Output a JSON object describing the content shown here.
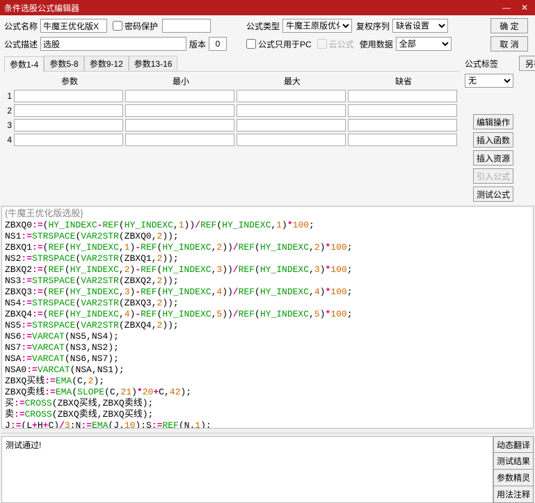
{
  "title": "条件选股公式编辑器",
  "win": {
    "min": "—",
    "close": "✕"
  },
  "labels": {
    "name": "公式名称",
    "pwd": "密码保护",
    "desc": "公式描述",
    "ver": "版本",
    "type": "公式类型",
    "seq": "复权序列",
    "pconly": "公式只用于PC",
    "cloud": "云公式",
    "usedata": "使用数据",
    "tag": "公式标签"
  },
  "vals": {
    "name": "牛魔王优化版X",
    "desc": "选股",
    "ver": "0",
    "type": "牛魔王原版优化",
    "seq": "缺省设置",
    "usedata": "全部",
    "tag": "无"
  },
  "buttons": {
    "ok": "确 定",
    "cancel": "取 消",
    "saveas": "另存为",
    "editop": "编辑操作",
    "insfunc": "插入函数",
    "insres": "插入资源",
    "import": "引入公式",
    "test": "测试公式",
    "dyn": "动态翻译",
    "result": "测试结果",
    "paramwiz": "参数精灵",
    "usage": "用法注释"
  },
  "tabs": [
    "参数1-4",
    "参数5-8",
    "参数9-12",
    "参数13-16"
  ],
  "paramHeaders": [
    "参数",
    "最小",
    "最大",
    "缺省"
  ],
  "paramRows": [
    "1",
    "2",
    "3",
    "4"
  ],
  "codeTitle": "{牛魔王优化版选股}",
  "code": [
    {
      "segs": [
        [
          "k",
          "ZBXQ0"
        ],
        [
          "o",
          ":="
        ],
        [
          "p",
          "("
        ],
        [
          "f",
          "HY_INDEXC"
        ],
        [
          "o",
          "-"
        ],
        [
          "f",
          "REF"
        ],
        [
          "p",
          "("
        ],
        [
          "f",
          "HY_INDEXC"
        ],
        [
          "p",
          ","
        ],
        [
          "n",
          "1"
        ],
        [
          "p",
          "))"
        ],
        [
          "o",
          "/"
        ],
        [
          "f",
          "REF"
        ],
        [
          "p",
          "("
        ],
        [
          "f",
          "HY_INDEXC"
        ],
        [
          "p",
          ","
        ],
        [
          "n",
          "1"
        ],
        [
          "p",
          ")"
        ],
        [
          "o",
          "*"
        ],
        [
          "n",
          "100"
        ],
        [
          "p",
          ";"
        ]
      ]
    },
    {
      "segs": [
        [
          "k",
          "NS1"
        ],
        [
          "o",
          ":="
        ],
        [
          "f",
          "STRSPACE"
        ],
        [
          "p",
          "("
        ],
        [
          "f",
          "VAR2STR"
        ],
        [
          "p",
          "("
        ],
        [
          "k",
          "ZBXQ0"
        ],
        [
          "p",
          ","
        ],
        [
          "n",
          "2"
        ],
        [
          "p",
          "));"
        ]
      ]
    },
    {
      "segs": [
        [
          "k",
          "ZBXQ1"
        ],
        [
          "o",
          ":="
        ],
        [
          "p",
          "("
        ],
        [
          "f",
          "REF"
        ],
        [
          "p",
          "("
        ],
        [
          "f",
          "HY_INDEXC"
        ],
        [
          "p",
          ","
        ],
        [
          "n",
          "1"
        ],
        [
          "p",
          ")"
        ],
        [
          "o",
          "-"
        ],
        [
          "f",
          "REF"
        ],
        [
          "p",
          "("
        ],
        [
          "f",
          "HY_INDEXC"
        ],
        [
          "p",
          ","
        ],
        [
          "n",
          "2"
        ],
        [
          "p",
          "))"
        ],
        [
          "o",
          "/"
        ],
        [
          "f",
          "REF"
        ],
        [
          "p",
          "("
        ],
        [
          "f",
          "HY_INDEXC"
        ],
        [
          "p",
          ","
        ],
        [
          "n",
          "2"
        ],
        [
          "p",
          ")"
        ],
        [
          "o",
          "*"
        ],
        [
          "n",
          "100"
        ],
        [
          "p",
          ";"
        ]
      ]
    },
    {
      "segs": [
        [
          "k",
          "NS2"
        ],
        [
          "o",
          ":="
        ],
        [
          "f",
          "STRSPACE"
        ],
        [
          "p",
          "("
        ],
        [
          "f",
          "VAR2STR"
        ],
        [
          "p",
          "("
        ],
        [
          "k",
          "ZBXQ1"
        ],
        [
          "p",
          ","
        ],
        [
          "n",
          "2"
        ],
        [
          "p",
          "));"
        ]
      ]
    },
    {
      "segs": [
        [
          "k",
          "ZBXQ2"
        ],
        [
          "o",
          ":="
        ],
        [
          "p",
          "("
        ],
        [
          "f",
          "REF"
        ],
        [
          "p",
          "("
        ],
        [
          "f",
          "HY_INDEXC"
        ],
        [
          "p",
          ","
        ],
        [
          "n",
          "2"
        ],
        [
          "p",
          ")"
        ],
        [
          "o",
          "-"
        ],
        [
          "f",
          "REF"
        ],
        [
          "p",
          "("
        ],
        [
          "f",
          "HY_INDEXC"
        ],
        [
          "p",
          ","
        ],
        [
          "n",
          "3"
        ],
        [
          "p",
          "))"
        ],
        [
          "o",
          "/"
        ],
        [
          "f",
          "REF"
        ],
        [
          "p",
          "("
        ],
        [
          "f",
          "HY_INDEXC"
        ],
        [
          "p",
          ","
        ],
        [
          "n",
          "3"
        ],
        [
          "p",
          ")"
        ],
        [
          "o",
          "*"
        ],
        [
          "n",
          "100"
        ],
        [
          "p",
          ";"
        ]
      ]
    },
    {
      "segs": [
        [
          "k",
          "NS3"
        ],
        [
          "o",
          ":="
        ],
        [
          "f",
          "STRSPACE"
        ],
        [
          "p",
          "("
        ],
        [
          "f",
          "VAR2STR"
        ],
        [
          "p",
          "("
        ],
        [
          "k",
          "ZBXQ2"
        ],
        [
          "p",
          ","
        ],
        [
          "n",
          "2"
        ],
        [
          "p",
          "));"
        ]
      ]
    },
    {
      "segs": [
        [
          "k",
          "ZBXQ3"
        ],
        [
          "o",
          ":="
        ],
        [
          "p",
          "("
        ],
        [
          "f",
          "REF"
        ],
        [
          "p",
          "("
        ],
        [
          "f",
          "HY_INDEXC"
        ],
        [
          "p",
          ","
        ],
        [
          "n",
          "3"
        ],
        [
          "p",
          ")"
        ],
        [
          "o",
          "-"
        ],
        [
          "f",
          "REF"
        ],
        [
          "p",
          "("
        ],
        [
          "f",
          "HY_INDEXC"
        ],
        [
          "p",
          ","
        ],
        [
          "n",
          "4"
        ],
        [
          "p",
          "))"
        ],
        [
          "o",
          "/"
        ],
        [
          "f",
          "REF"
        ],
        [
          "p",
          "("
        ],
        [
          "f",
          "HY_INDEXC"
        ],
        [
          "p",
          ","
        ],
        [
          "n",
          "4"
        ],
        [
          "p",
          ")"
        ],
        [
          "o",
          "*"
        ],
        [
          "n",
          "100"
        ],
        [
          "p",
          ";"
        ]
      ]
    },
    {
      "segs": [
        [
          "k",
          "NS4"
        ],
        [
          "o",
          ":="
        ],
        [
          "f",
          "STRSPACE"
        ],
        [
          "p",
          "("
        ],
        [
          "f",
          "VAR2STR"
        ],
        [
          "p",
          "("
        ],
        [
          "k",
          "ZBXQ3"
        ],
        [
          "p",
          ","
        ],
        [
          "n",
          "2"
        ],
        [
          "p",
          "));"
        ]
      ]
    },
    {
      "segs": [
        [
          "k",
          "ZBXQ4"
        ],
        [
          "o",
          ":="
        ],
        [
          "p",
          "("
        ],
        [
          "f",
          "REF"
        ],
        [
          "p",
          "("
        ],
        [
          "f",
          "HY_INDEXC"
        ],
        [
          "p",
          ","
        ],
        [
          "n",
          "4"
        ],
        [
          "p",
          ")"
        ],
        [
          "o",
          "-"
        ],
        [
          "f",
          "REF"
        ],
        [
          "p",
          "("
        ],
        [
          "f",
          "HY_INDEXC"
        ],
        [
          "p",
          ","
        ],
        [
          "n",
          "5"
        ],
        [
          "p",
          "))"
        ],
        [
          "o",
          "/"
        ],
        [
          "f",
          "REF"
        ],
        [
          "p",
          "("
        ],
        [
          "f",
          "HY_INDEXC"
        ],
        [
          "p",
          ","
        ],
        [
          "n",
          "5"
        ],
        [
          "p",
          ")"
        ],
        [
          "o",
          "*"
        ],
        [
          "n",
          "100"
        ],
        [
          "p",
          ";"
        ]
      ]
    },
    {
      "segs": [
        [
          "k",
          "NS5"
        ],
        [
          "o",
          ":="
        ],
        [
          "f",
          "STRSPACE"
        ],
        [
          "p",
          "("
        ],
        [
          "f",
          "VAR2STR"
        ],
        [
          "p",
          "("
        ],
        [
          "k",
          "ZBXQ4"
        ],
        [
          "p",
          ","
        ],
        [
          "n",
          "2"
        ],
        [
          "p",
          "));"
        ]
      ]
    },
    {
      "segs": [
        [
          "k",
          "NS6"
        ],
        [
          "o",
          ":="
        ],
        [
          "f",
          "VARCAT"
        ],
        [
          "p",
          "("
        ],
        [
          "k",
          "NS5"
        ],
        [
          "p",
          ","
        ],
        [
          "k",
          "NS4"
        ],
        [
          "p",
          ");"
        ]
      ]
    },
    {
      "segs": [
        [
          "k",
          "NS7"
        ],
        [
          "o",
          ":="
        ],
        [
          "f",
          "VARCAT"
        ],
        [
          "p",
          "("
        ],
        [
          "k",
          "NS3"
        ],
        [
          "p",
          ","
        ],
        [
          "k",
          "NS2"
        ],
        [
          "p",
          ");"
        ]
      ]
    },
    {
      "segs": [
        [
          "k",
          "NSA"
        ],
        [
          "o",
          ":="
        ],
        [
          "f",
          "VARCAT"
        ],
        [
          "p",
          "("
        ],
        [
          "k",
          "NS6"
        ],
        [
          "p",
          ","
        ],
        [
          "k",
          "NS7"
        ],
        [
          "p",
          ");"
        ]
      ]
    },
    {
      "segs": [
        [
          "k",
          "NSA0"
        ],
        [
          "o",
          ":="
        ],
        [
          "f",
          "VARCAT"
        ],
        [
          "p",
          "("
        ],
        [
          "k",
          "NSA"
        ],
        [
          "p",
          ","
        ],
        [
          "k",
          "NS1"
        ],
        [
          "p",
          ");"
        ]
      ]
    },
    {
      "segs": [
        [
          "k",
          "ZBXQ买线"
        ],
        [
          "o",
          ":="
        ],
        [
          "f",
          "EMA"
        ],
        [
          "p",
          "("
        ],
        [
          "k",
          "C"
        ],
        [
          "p",
          ","
        ],
        [
          "n",
          "2"
        ],
        [
          "p",
          ");"
        ]
      ]
    },
    {
      "segs": [
        [
          "k",
          "ZBXQ卖线"
        ],
        [
          "o",
          ":="
        ],
        [
          "f",
          "EMA"
        ],
        [
          "p",
          "("
        ],
        [
          "f",
          "SLOPE"
        ],
        [
          "p",
          "("
        ],
        [
          "k",
          "C"
        ],
        [
          "p",
          ","
        ],
        [
          "n",
          "21"
        ],
        [
          "p",
          ")"
        ],
        [
          "o",
          "*"
        ],
        [
          "n",
          "20"
        ],
        [
          "o",
          "+"
        ],
        [
          "k",
          "C"
        ],
        [
          "p",
          ","
        ],
        [
          "n",
          "42"
        ],
        [
          "p",
          ");"
        ]
      ]
    },
    {
      "segs": [
        [
          "k",
          "买"
        ],
        [
          "o",
          ":="
        ],
        [
          "f",
          "CROSS"
        ],
        [
          "p",
          "("
        ],
        [
          "k",
          "ZBXQ买线"
        ],
        [
          "p",
          ","
        ],
        [
          "k",
          "ZBXQ卖线"
        ],
        [
          "p",
          ");"
        ]
      ]
    },
    {
      "segs": [
        [
          "k",
          "卖"
        ],
        [
          "o",
          ":="
        ],
        [
          "f",
          "CROSS"
        ],
        [
          "p",
          "("
        ],
        [
          "k",
          "ZBXQ卖线"
        ],
        [
          "p",
          ","
        ],
        [
          "k",
          "ZBXQ买线"
        ],
        [
          "p",
          ");"
        ]
      ]
    },
    {
      "segs": [
        [
          "k",
          "J"
        ],
        [
          "o",
          ":="
        ],
        [
          "p",
          "("
        ],
        [
          "k",
          "L"
        ],
        [
          "o",
          "+"
        ],
        [
          "k",
          "H"
        ],
        [
          "o",
          "+"
        ],
        [
          "k",
          "C"
        ],
        [
          "p",
          ")"
        ],
        [
          "o",
          "/"
        ],
        [
          "n",
          "3"
        ],
        [
          "p",
          ";"
        ],
        [
          "k",
          "N"
        ],
        [
          "o",
          ":="
        ],
        [
          "f",
          "EMA"
        ],
        [
          "p",
          "("
        ],
        [
          "k",
          "J"
        ],
        [
          "p",
          "."
        ],
        [
          "n",
          "10"
        ],
        [
          "p",
          ");"
        ],
        [
          "k",
          "S"
        ],
        [
          "o",
          ":="
        ],
        [
          "f",
          "REF"
        ],
        [
          "p",
          "("
        ],
        [
          "k",
          "N"
        ],
        [
          "p",
          "."
        ],
        [
          "n",
          "1"
        ],
        [
          "p",
          ");"
        ]
      ]
    }
  ],
  "msg": "测试通过!"
}
